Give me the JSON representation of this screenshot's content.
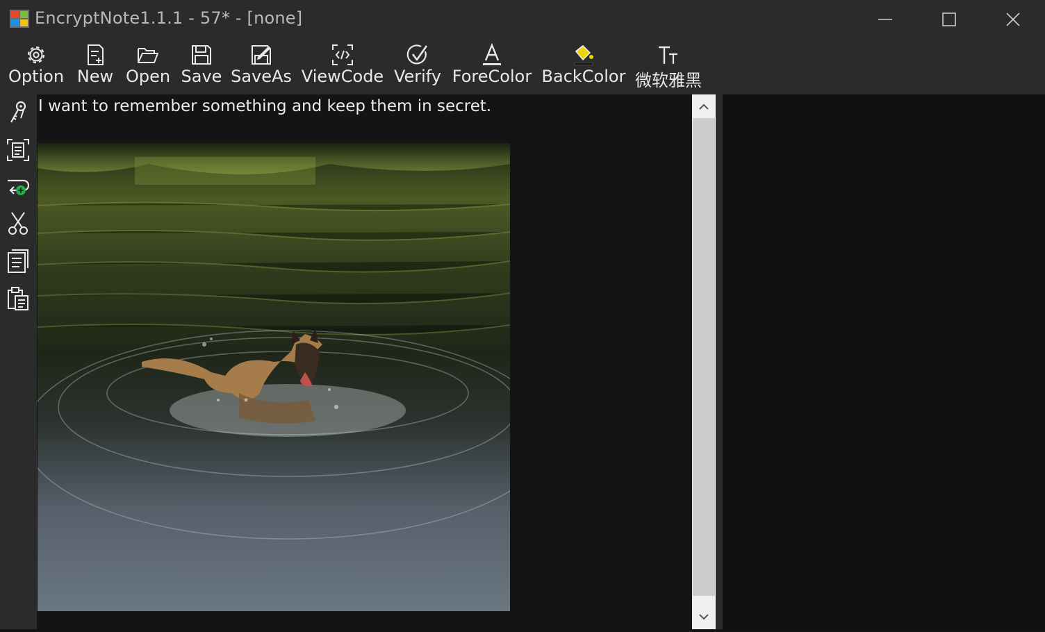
{
  "window": {
    "title": "EncryptNote1.1.1 - 57* - [none]",
    "app_icon": "windows-logo-icon",
    "controls": [
      "minimize-icon",
      "maximize-icon",
      "close-icon"
    ]
  },
  "toolbar": {
    "buttons": [
      {
        "label": "Option",
        "icon": "gear-icon"
      },
      {
        "label": "New",
        "icon": "new-document-icon"
      },
      {
        "label": "Open",
        "icon": "folder-open-icon"
      },
      {
        "label": "Save",
        "icon": "floppy-disk-icon"
      },
      {
        "label": "SaveAs",
        "icon": "save-as-icon"
      },
      {
        "label": "ViewCode",
        "icon": "code-icon"
      },
      {
        "label": "Verify",
        "icon": "check-circle-icon"
      },
      {
        "label": "ForeColor",
        "icon": "font-color-icon"
      },
      {
        "label": "BackColor",
        "icon": "paint-bucket-icon"
      },
      {
        "label": "微软雅黑",
        "icon": "font-size-icon"
      }
    ]
  },
  "sidebar": {
    "tools": [
      "keys-icon",
      "select-all-icon",
      "word-wrap-icon",
      "cut-icon",
      "copy-icon",
      "paste-icon"
    ]
  },
  "editor": {
    "text": "I want to remember something and keep them in secret.",
    "image": "photo-dog-in-water"
  },
  "colors": {
    "chrome": "#2b2b2b",
    "editor_bg": "#141414",
    "text": "#ececec",
    "backcolor_accent": "#f0d400",
    "wrap_accent": "#22b14c"
  }
}
